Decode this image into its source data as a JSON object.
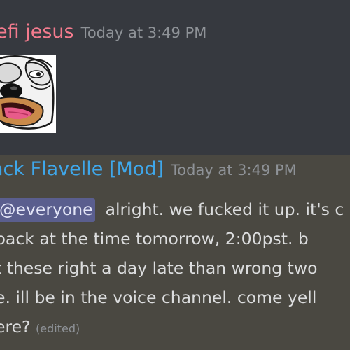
{
  "messages": [
    {
      "username": "efi jesus",
      "timestamp": "Today at 3:49 PM",
      "name_color": "#f47b8e",
      "attachment": {
        "type": "emote",
        "icon": "cartoon-dog-face-emote"
      }
    },
    {
      "username": "ack Flavelle [Mod]",
      "timestamp": "Today at 3:49 PM",
      "name_color": "#3fa7ea",
      "mention": "everyone",
      "lines": [
        "alright. we fucked it up. it's c",
        "back at the time tomorrow, 2:00pst. b",
        "t these right a day late than wrong two",
        "e. ill be in the voice channel. come yell",
        "ere?"
      ],
      "edited_label": "(edited)"
    }
  ],
  "colors": {
    "background": "#36393f",
    "highlighted_message_bg": "#4a4841",
    "mention_bg": "#5a5e8e",
    "text": "#dcddde",
    "muted": "#8e9297"
  }
}
